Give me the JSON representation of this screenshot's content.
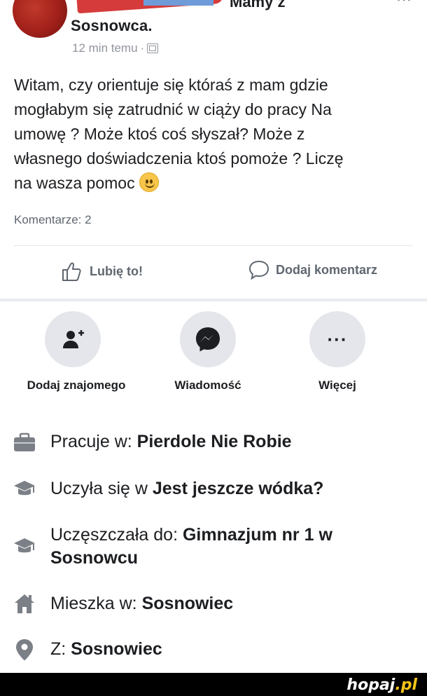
{
  "post": {
    "group_name_tail": "Mamy z",
    "group_name_line2": "Sosnowca.",
    "timestamp": "12 min temu",
    "separator": "·",
    "body": "Witam, czy orientuje się któraś z mam gdzie\nmogłabym się zatrudnić w ciąży do pracy Na\numowę ? Może ktoś coś słyszał? Może z\nwłasnego doświadczenia ktoś pomoże ? Liczę\nna wasza pomoc",
    "comments_count": "Komentarze: 2",
    "like_label": "Lubię to!",
    "comment_label": "Dodaj komentarz"
  },
  "profile_actions": [
    {
      "label": "Dodaj znajomego",
      "icon": "add-friend-icon"
    },
    {
      "label": "Wiadomość",
      "icon": "messenger-icon"
    },
    {
      "label": "Więcej",
      "icon": "more-icon"
    }
  ],
  "about": {
    "work": {
      "prefix": "Pracuje w: ",
      "value": "Pierdole Nie Robie",
      "icon": "briefcase-icon"
    },
    "studied": {
      "prefix": "Uczyła się w ",
      "value": "Jest jeszcze wódka?",
      "icon": "graduation-cap-icon"
    },
    "attended": {
      "prefix": "Uczęszczała do: ",
      "value_line1": "Gimnazjum nr 1 w",
      "value_line2": "Sosnowcu",
      "icon": "graduation-cap-icon"
    },
    "lives": {
      "prefix": "Mieszka w: ",
      "value": "Sosnowiec",
      "icon": "home-icon"
    },
    "from": {
      "prefix": "Z: ",
      "value": "Sosnowiec",
      "icon": "location-pin-icon"
    }
  },
  "watermark": {
    "name": "hopaj",
    "tld": ".pl"
  }
}
